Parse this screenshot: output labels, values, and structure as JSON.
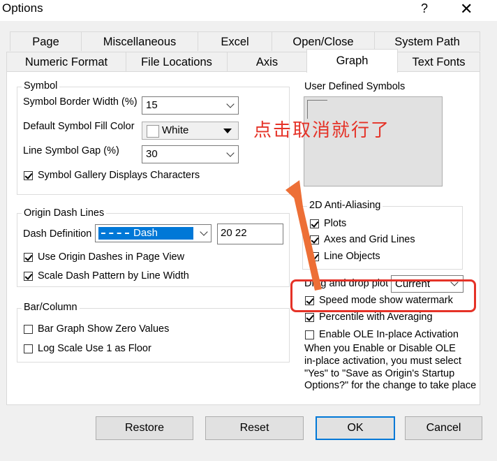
{
  "window": {
    "title": "Options",
    "help": "?",
    "close": "✕"
  },
  "tabs_row1": [
    "Page",
    "Miscellaneous",
    "Excel",
    "Open/Close",
    "System Path"
  ],
  "tabs_row2": [
    "Numeric Format",
    "File Locations",
    "Axis",
    "Graph",
    "Text Fonts"
  ],
  "selected_tab": "Graph",
  "symbol": {
    "group_label": "Symbol",
    "border_width_label": "Symbol Border Width (%)",
    "border_width_value": "15",
    "fill_color_label": "Default Symbol Fill Color",
    "fill_color_value": "White",
    "gap_label": "Line Symbol Gap (%)",
    "gap_value": "30",
    "gallery_label": "Symbol Gallery Displays Characters"
  },
  "dash": {
    "group_label": "Origin Dash Lines",
    "definition_label": "Dash Definition",
    "definition_value": "Dash",
    "definition_numbers": "20 22",
    "use_origin_label": "Use Origin Dashes in Page View",
    "scale_label": "Scale Dash Pattern by Line Width"
  },
  "bar": {
    "group_label": "Bar/Column",
    "zero_label": "Bar Graph Show Zero Values",
    "log_label": "Log Scale Use 1 as Floor"
  },
  "user_symbols": {
    "label": "User Defined Symbols"
  },
  "antialias": {
    "group_label": "2D Anti-Aliasing",
    "plots": "Plots",
    "axes": "Axes and Grid Lines",
    "lines": "Line Objects"
  },
  "drag": {
    "label": "Drag and drop plot",
    "value": "Current"
  },
  "speed_label": "Speed mode show watermark",
  "percentile_label": "Percentile with Averaging",
  "ole_label": "Enable OLE In-place Activation",
  "ole_note": [
    "When you Enable or Disable OLE",
    "in-place activation, you must select",
    "\"Yes\" to \"Save as Origin's Startup",
    "Options?\" for the change to take place"
  ],
  "buttons": {
    "restore": "Restore",
    "reset": "Reset",
    "ok": "OK",
    "cancel": "Cancel"
  },
  "annotation": {
    "text": "点击取消就行了",
    "color": "#e53227"
  }
}
